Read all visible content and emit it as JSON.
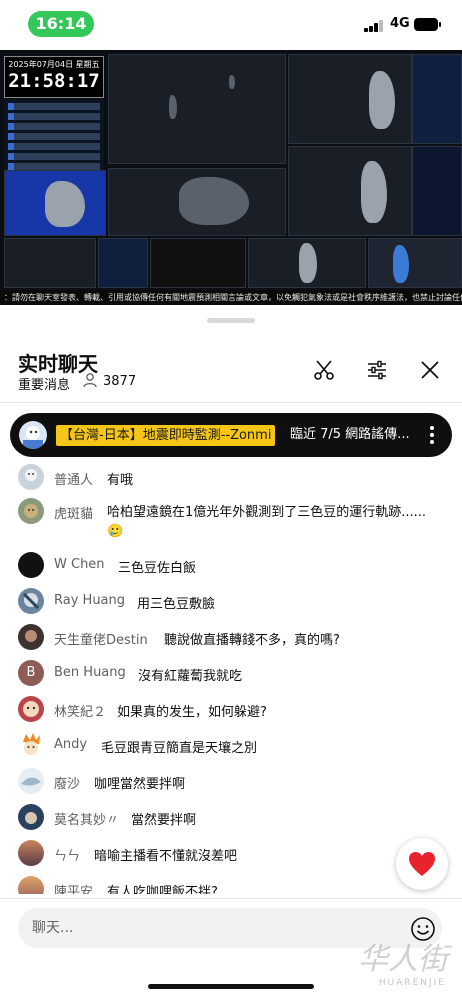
{
  "status_bar": {
    "time": "16:14",
    "network": "4G"
  },
  "video": {
    "date": "2025年07月04日 星期五",
    "clock": "21:58:17",
    "ticker": "：請勿在聊天室發表、轉載、引用或協傳任何有關地震預測相關言論或文章，以免觸犯氣象法或是社會秩序維護法，也禁止討論任何政治議題"
  },
  "chat": {
    "title": "实时聊天",
    "subtitle": "重要消息",
    "viewer_count": "3877",
    "pinned": {
      "channel": "【台灣-日本】地震即時監測--Zonmi",
      "message": "臨近 7/5 網路謠傳..."
    },
    "messages": [
      {
        "author": "普通人",
        "text": "有哦",
        "avatar_color": "#c9d3dc"
      },
      {
        "author": "虎斑貓",
        "text": "哈柏望遠鏡在1億光年外觀測到了三色豆的運行軌跡......",
        "emoji": "🥲",
        "avatar_color": "#8a9a7a"
      },
      {
        "author": "W Chen",
        "text": "三色豆佐白飯",
        "avatar_color": "#111111"
      },
      {
        "author": "Ray Huang",
        "text": "用三色豆敷臉",
        "avatar_color": "#6b86a0"
      },
      {
        "author": "天生童佬Destin",
        "text": "聽說做直播轉錢不多，真的嗎?",
        "avatar_color": "#3b3330"
      },
      {
        "author": "Ben Huang",
        "text": "沒有紅蘿蔔我就吃",
        "avatar_letter": "B",
        "avatar_color": "#8e5b55"
      },
      {
        "author": "林笑紀２",
        "text": "如果真的发生，如何躲避?",
        "avatar_color": "#b9454a"
      },
      {
        "author": "Andy",
        "text": "毛豆跟青豆簡直是天壤之別",
        "avatar_color": "#f08a24"
      },
      {
        "author": "廢沙",
        "text": "咖哩當然要拌啊",
        "avatar_color": "#9fb7c9"
      },
      {
        "author": "莫名其妙〃",
        "text": "當然要拌啊",
        "avatar_color": "#27415e"
      },
      {
        "author": "ㄣㄣ",
        "text": "暗喻主播看不懂就沒差吧",
        "avatar_color": "#c9855c"
      },
      {
        "author": "陳平安",
        "text": "有人吃咖哩飯不拌?",
        "avatar_color": "#e0a36a"
      }
    ],
    "input_placeholder": "聊天..."
  },
  "colors": {
    "pinned_bg": "#0f0f0f",
    "tag_bg": "#f5c518",
    "heart": "#e8232e",
    "status_green": "#34c759"
  },
  "watermark": {
    "text": "华人街",
    "subtext": "HUARENJIE"
  }
}
